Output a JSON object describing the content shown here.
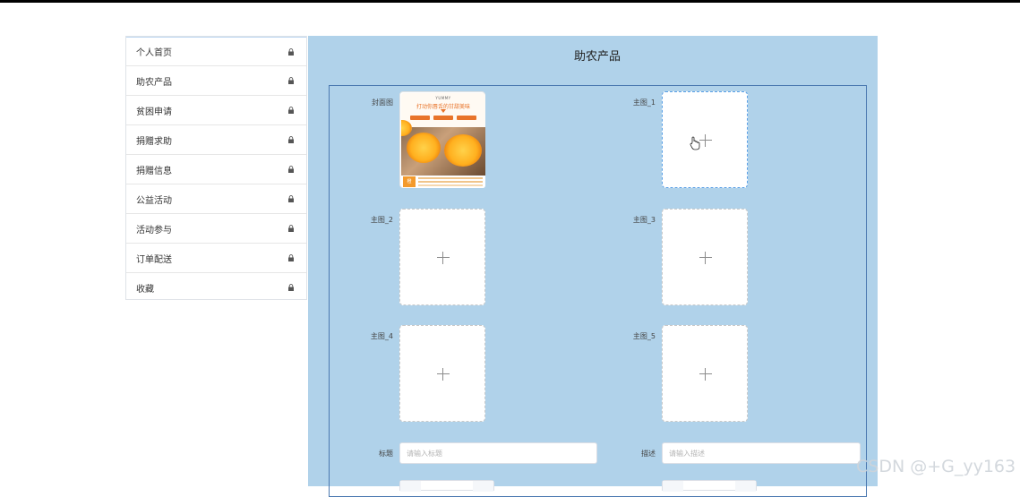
{
  "sidebar": {
    "items": [
      {
        "label": "个人首页"
      },
      {
        "label": "助农产品"
      },
      {
        "label": "贫困申请"
      },
      {
        "label": "捐赠求助"
      },
      {
        "label": "捐赠信息"
      },
      {
        "label": "公益活动"
      },
      {
        "label": "活动参与"
      },
      {
        "label": "订单配送"
      },
      {
        "label": "收藏"
      }
    ],
    "item_icon": "lock-icon"
  },
  "main": {
    "title": "助农产品",
    "background": "#b0d2ea",
    "border_color": "#4a78b0"
  },
  "form": {
    "cover": {
      "label": "封面图",
      "poster": {
        "brand": "YUMMY",
        "headline": "打动你唇舌的甘甜美味",
        "badge": "橙"
      }
    },
    "images": [
      {
        "label": "主图_1"
      },
      {
        "label": "主图_2"
      },
      {
        "label": "主图_3"
      },
      {
        "label": "主图_4"
      },
      {
        "label": "主图_5"
      }
    ],
    "title_field": {
      "label": "标题",
      "placeholder": "请输入标题"
    },
    "desc_field": {
      "label": "描述",
      "placeholder": "请输入描述"
    }
  },
  "watermark": "CSDN @+G_yy163"
}
